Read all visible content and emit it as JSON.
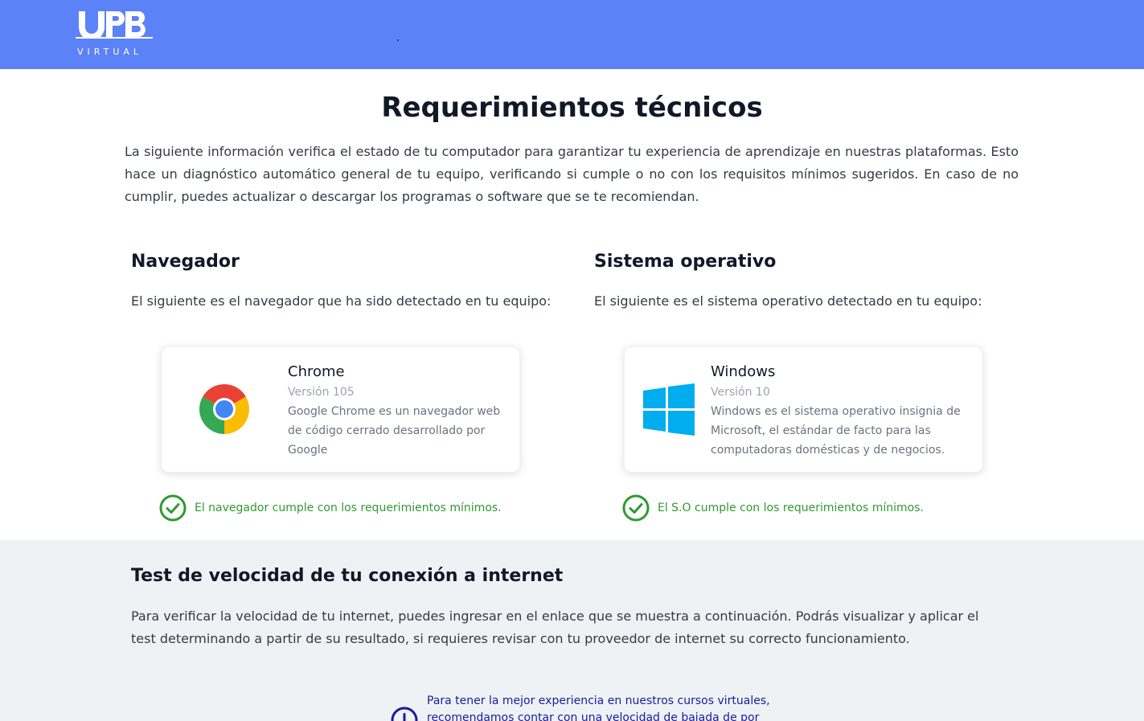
{
  "header": {
    "logo_mark": "UPB",
    "logo_sub": "VIRTUAL"
  },
  "page": {
    "title": "Requerimientos técnicos",
    "intro": "La siguiente información verifica el estado de tu computador para garantizar tu experiencia de aprendizaje en nuestras plataformas. Esto hace un diagnóstico automático general de tu equipo, verificando si cumple o no con los requisitos mínimos sugeridos. En caso de no cumplir, puedes actualizar o descargar los programas o software que se te recomiendan."
  },
  "browser": {
    "section_title": "Navegador",
    "section_desc": "El siguiente es el navegador que ha sido detectado en tu equipo:",
    "name": "Chrome",
    "version": "Versión 105",
    "description": "Google Chrome es un navegador web de código cerrado desarrollado por Google",
    "icon": "chrome-icon",
    "status": "El navegador cumple con los requerimientos mínimos."
  },
  "os": {
    "section_title": "Sistema operativo",
    "section_desc": "El siguiente es el sistema operativo detectado en tu equipo:",
    "name": "Windows",
    "version": "Versión 10",
    "description": "Windows es el sistema operativo insignia de Microsoft, el estándar de facto para las computadoras domésticas y de negocios.",
    "icon": "windows-icon",
    "status": "El S.O cumple con los requerimientos mínimos."
  },
  "speed_test": {
    "title": "Test de velocidad de tu conexión a internet",
    "description": "Para verificar la velocidad de tu internet, puedes ingresar en el enlace que se muestra a continuación. Podrás visualizar y aplicar el test determinando a partir de su resultado, si requieres revisar con tu proveedor de internet su correcto funcionamiento.",
    "note": "Para tener la mejor experiencia en nuestros cursos virtuales, recomendamos contar con una velocidad de bajada de por"
  },
  "colors": {
    "header_bg": "#5b82f7",
    "success": "#2f9a2f",
    "note_text": "#1a1aa0",
    "section_bg": "#eff2f5"
  }
}
